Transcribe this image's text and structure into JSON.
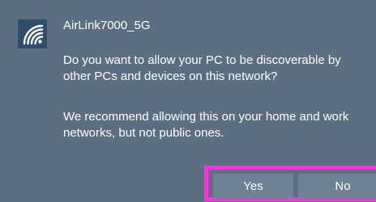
{
  "network": {
    "name": "AirLink7000_5G",
    "icon": "wifi-icon"
  },
  "prompt": {
    "line1": "Do you want to allow your PC to be discoverable by",
    "line2": "other PCs and devices on this network?"
  },
  "recommendation": {
    "line1": "We recommend allowing this on your home and work",
    "line2": "networks, but not public ones."
  },
  "buttons": {
    "yes_label": "Yes",
    "no_label": "No"
  },
  "colors": {
    "panel_background": "#5b6f80",
    "icon_tile": "#2f4e6c",
    "button_background": "#6f8294",
    "highlight_border": "#ff33d6",
    "text": "#ffffff"
  }
}
